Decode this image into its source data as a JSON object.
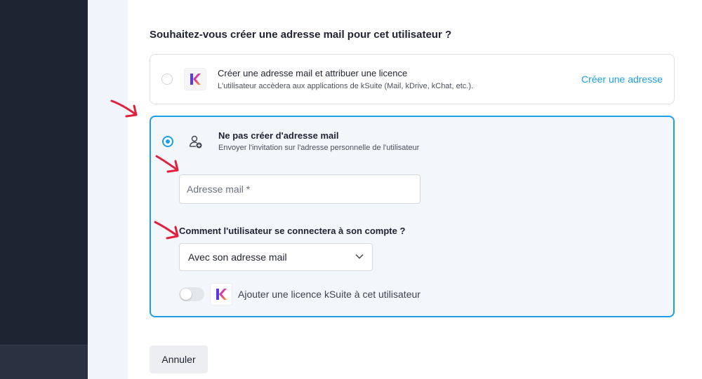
{
  "question": "Souhaitez-vous créer une adresse mail pour cet utilisateur ?",
  "options": [
    {
      "title": "Créer une adresse mail et attribuer une licence",
      "subtitle": "L'utilisateur accèdera aux applications de kSuite (Mail, kDrive, kChat, etc.).",
      "action": "Créer une adresse",
      "selected": false,
      "icon": "ksuite-logo"
    },
    {
      "title": "Ne pas créer d'adresse mail",
      "subtitle": "Envoyer l'invitation sur l'adresse personnelle de l'utilisateur",
      "selected": true,
      "icon": "user-add-icon"
    }
  ],
  "form": {
    "email_placeholder": "Adresse mail *",
    "email_value": "",
    "login_question": "Comment l'utilisateur se connectera à son compte ?",
    "login_selected": "Avec son adresse mail",
    "license_toggle_label": "Ajouter une licence kSuite à cet utilisateur",
    "license_toggle_on": false
  },
  "footer": {
    "cancel_label": "Annuler"
  },
  "colors": {
    "accent": "#1d9ee6",
    "annotation": "#e0203c",
    "sidebar": "#1f2433",
    "selected_bg": "#f3f6fb"
  }
}
